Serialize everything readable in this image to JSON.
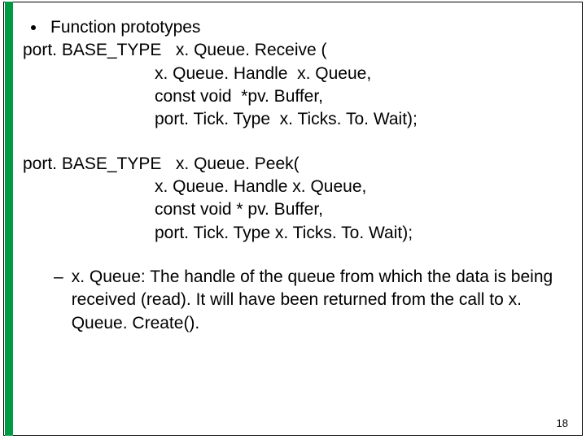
{
  "bullet_label": "Function prototypes",
  "proto1": {
    "sig": "port. BASE_TYPE   x. Queue. Receive (",
    "p1": "x. Queue. Handle  x. Queue,",
    "p2": "const void  *pv. Buffer,",
    "p3": "port. Tick. Type  x. Ticks. To. Wait);"
  },
  "proto2": {
    "sig": "port. BASE_TYPE   x. Queue. Peek(",
    "p1": "x. Queue. Handle x. Queue,",
    "p2": "const void * pv. Buffer,",
    "p3": "port. Tick. Type x. Ticks. To. Wait);"
  },
  "sub_bullet_dash": "–",
  "sub_bullet_text": "x. Queue: The handle of the queue from which the data is being received (read). It will have been returned from the call to x. Queue. Create().",
  "page_number": "18"
}
